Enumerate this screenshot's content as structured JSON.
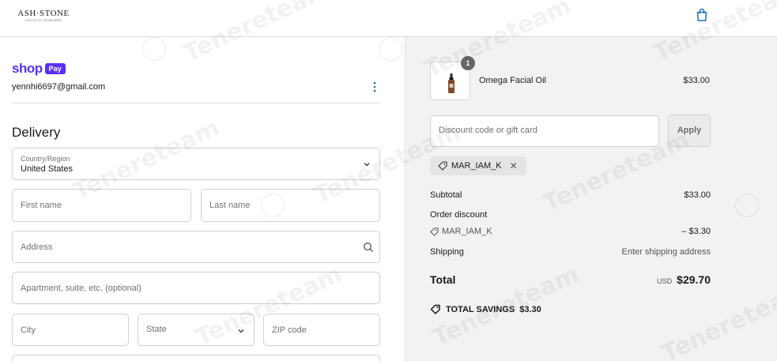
{
  "header": {
    "logo_text": "ASH·STONE",
    "logo_sub": "HOLISTIC SKINCARE",
    "cart_icon": "shopping-bag-icon"
  },
  "account": {
    "shop_word": "shop",
    "pay_badge": "Pay",
    "email": "yennhi6697@gmail.com",
    "menu_icon": "kebab-menu-icon"
  },
  "delivery": {
    "title": "Delivery",
    "country_label": "Country/Region",
    "country_value": "United States",
    "first_name_placeholder": "First name",
    "last_name_placeholder": "Last name",
    "address_placeholder": "Address",
    "apartment_placeholder": "Apartment, suite, etc. (optional)",
    "city_placeholder": "City",
    "state_placeholder": "State",
    "zip_placeholder": "ZIP code"
  },
  "summary": {
    "item": {
      "name": "Omega Facial Oil",
      "price": "$33.00",
      "quantity": "1"
    },
    "discount_placeholder": "Discount code or gift card",
    "apply_label": "Apply",
    "applied_code": "MAR_IAM_K",
    "subtotal_label": "Subtotal",
    "subtotal_value": "$33.00",
    "order_discount_label": "Order discount",
    "discount_code": "MAR_IAM_K",
    "discount_value": "– $3.30",
    "shipping_label": "Shipping",
    "shipping_value": "Enter shipping address",
    "total_label": "Total",
    "currency": "USD",
    "total_value": "$29.70",
    "savings_label": "TOTAL SAVINGS",
    "savings_value": "$3.30"
  },
  "watermark": {
    "text": "Tenereteam"
  },
  "colors": {
    "shop_pay": "#5a31f4",
    "summary_bg": "#f2f2f2",
    "link_blue": "#1773b0"
  }
}
